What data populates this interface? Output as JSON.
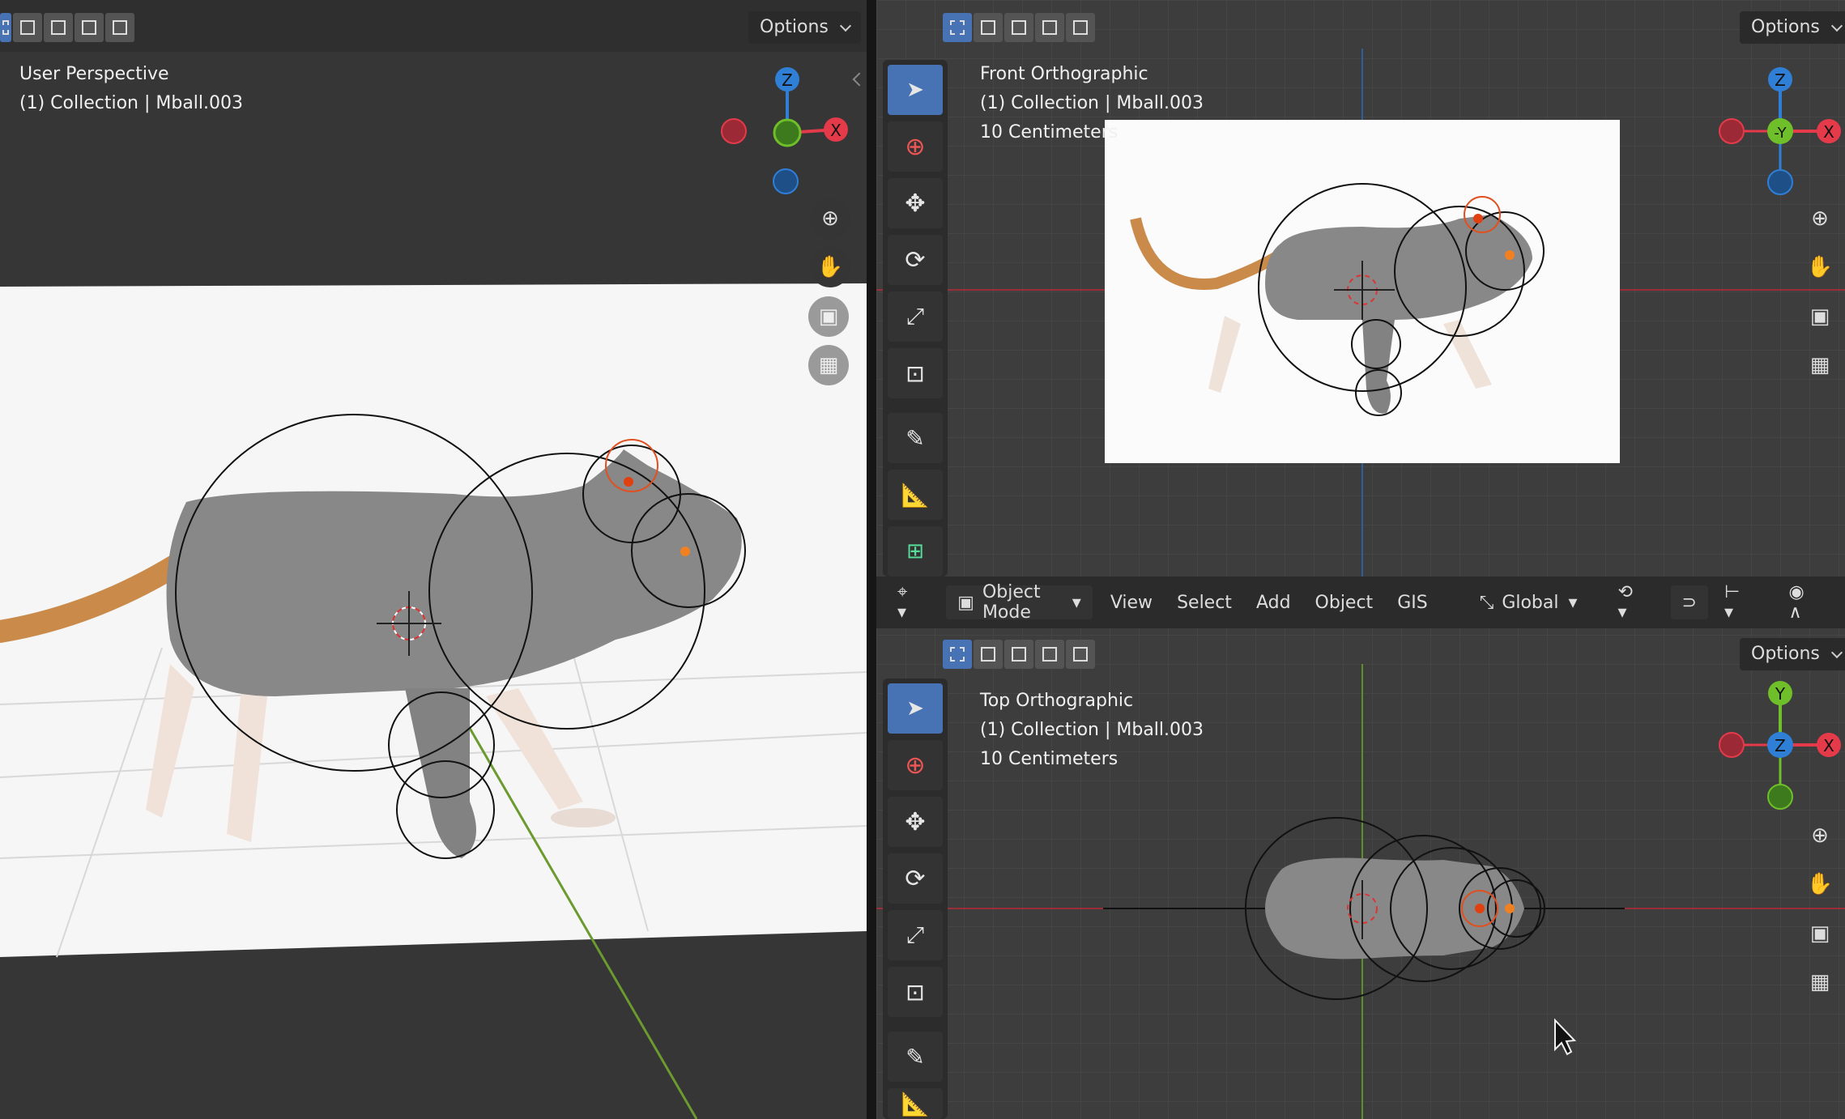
{
  "left_view": {
    "title": "User Perspective",
    "collection": "(1) Collection | Mball.003",
    "options_label": "Options"
  },
  "front_view": {
    "title": "Front Orthographic",
    "collection": "(1) Collection | Mball.003",
    "scale": "10 Centimeters",
    "options_label": "Options"
  },
  "top_view": {
    "title": "Top Orthographic",
    "collection": "(1) Collection | Mball.003",
    "scale": "10 Centimeters",
    "options_label": "Options"
  },
  "header": {
    "mode": "Object Mode",
    "menus": [
      "View",
      "Select",
      "Add",
      "Object",
      "GIS"
    ],
    "orientation": "Global"
  },
  "gizmo": {
    "z": "Z",
    "x": "X",
    "y": "Y",
    "neg_y": "-Y"
  },
  "colors": {
    "x_axis": "#e53a4a",
    "y_axis": "#6fbf2a",
    "z_axis": "#2f7fd6",
    "accent": "#4772b3",
    "origin": "#f08020"
  }
}
